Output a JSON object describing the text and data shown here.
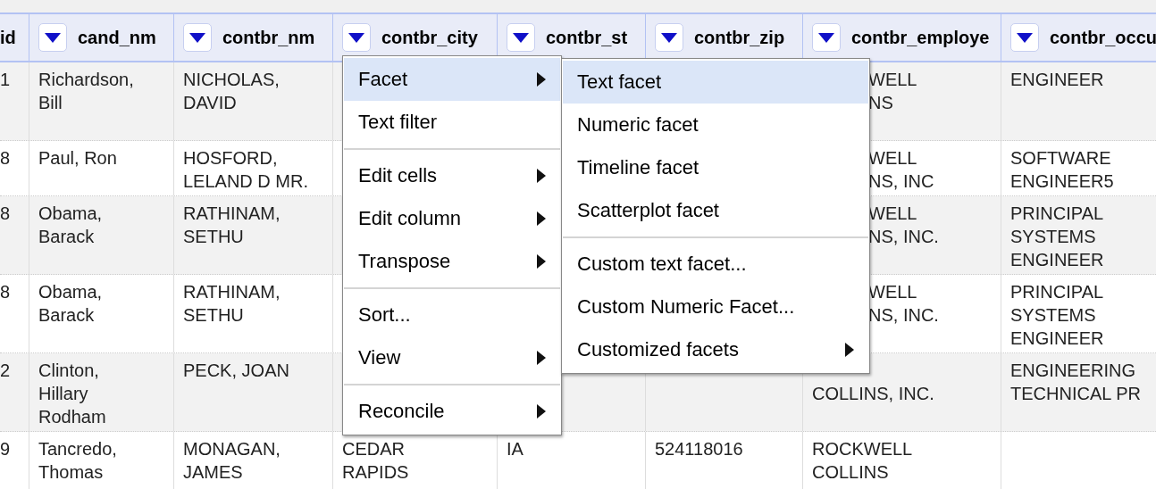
{
  "columns": [
    {
      "label": "id",
      "has_menu": false
    },
    {
      "label": "cand_nm",
      "has_menu": true
    },
    {
      "label": "contbr_nm",
      "has_menu": true
    },
    {
      "label": "contbr_city",
      "has_menu": true
    },
    {
      "label": "contbr_st",
      "has_menu": true
    },
    {
      "label": "contbr_zip",
      "has_menu": true
    },
    {
      "label": "contbr_employe",
      "has_menu": true
    },
    {
      "label": "contbr_occu",
      "has_menu": true
    }
  ],
  "rows": [
    {
      "cells": [
        "1",
        "Richardson,\nBill",
        "NICHOLAS,\nDAVID",
        null,
        null,
        null,
        {
          "text": "WELL\nNS",
          "partly_covered": true
        },
        "ENGINEER"
      ]
    },
    {
      "cells": [
        "8",
        "Paul, Ron",
        "HOSFORD,\nLELAND D MR.",
        null,
        null,
        null,
        {
          "text": "WELL\nNS, INC",
          "partly_covered": true
        },
        "SOFTWARE\nENGINEER5"
      ]
    },
    {
      "cells": [
        "8",
        "Obama,\nBarack",
        "RATHINAM,\nSETHU",
        null,
        null,
        null,
        {
          "text": "WELL\nNS, INC.",
          "partly_covered": true
        },
        "PRINCIPAL\nSYSTEMS\nENGINEER"
      ]
    },
    {
      "cells": [
        "8",
        "Obama,\nBarack",
        "RATHINAM,\nSETHU",
        null,
        null,
        null,
        {
          "text": "WELL\nNS, INC.",
          "partly_covered": true
        },
        "PRINCIPAL\nSYSTEMS\nENGINEER"
      ]
    },
    {
      "cells": [
        "2",
        "Clinton,\nHillary\nRodham",
        "PECK, JOAN",
        null,
        null,
        null,
        {
          "text": "\nCOLLINS, INC.",
          "partly_covered": false
        },
        "ENGINEERING\nTECHNICAL PR"
      ]
    },
    {
      "cells": [
        "9",
        "Tancredo,\nThomas",
        "MONAGAN,\nJAMES",
        "CEDAR\nRAPIDS",
        "IA",
        "524118016",
        "ROCKWELL\nCOLLINS",
        null
      ]
    }
  ],
  "column_menu": {
    "items": [
      {
        "kind": "item",
        "label": "Facet",
        "submenu": true,
        "selected": true
      },
      {
        "kind": "item",
        "label": "Text filter",
        "submenu": false,
        "selected": false
      },
      {
        "kind": "separator"
      },
      {
        "kind": "item",
        "label": "Edit cells",
        "submenu": true,
        "selected": false
      },
      {
        "kind": "item",
        "label": "Edit column",
        "submenu": true,
        "selected": false
      },
      {
        "kind": "item",
        "label": "Transpose",
        "submenu": true,
        "selected": false
      },
      {
        "kind": "separator"
      },
      {
        "kind": "item",
        "label": "Sort...",
        "submenu": false,
        "selected": false
      },
      {
        "kind": "item",
        "label": "View",
        "submenu": true,
        "selected": false
      },
      {
        "kind": "separator"
      },
      {
        "kind": "item",
        "label": "Reconcile",
        "submenu": true,
        "selected": false
      }
    ]
  },
  "facet_submenu": {
    "items": [
      {
        "kind": "item",
        "label": "Text facet",
        "submenu": false,
        "selected": true
      },
      {
        "kind": "item",
        "label": "Numeric facet",
        "submenu": false,
        "selected": false
      },
      {
        "kind": "item",
        "label": "Timeline facet",
        "submenu": false,
        "selected": false
      },
      {
        "kind": "item",
        "label": "Scatterplot facet",
        "submenu": false,
        "selected": false
      },
      {
        "kind": "separator"
      },
      {
        "kind": "item",
        "label": "Custom text facet...",
        "submenu": false,
        "selected": false
      },
      {
        "kind": "item",
        "label": "Custom Numeric Facet...",
        "submenu": false,
        "selected": false
      },
      {
        "kind": "item",
        "label": "Customized facets",
        "submenu": true,
        "selected": false
      }
    ]
  }
}
